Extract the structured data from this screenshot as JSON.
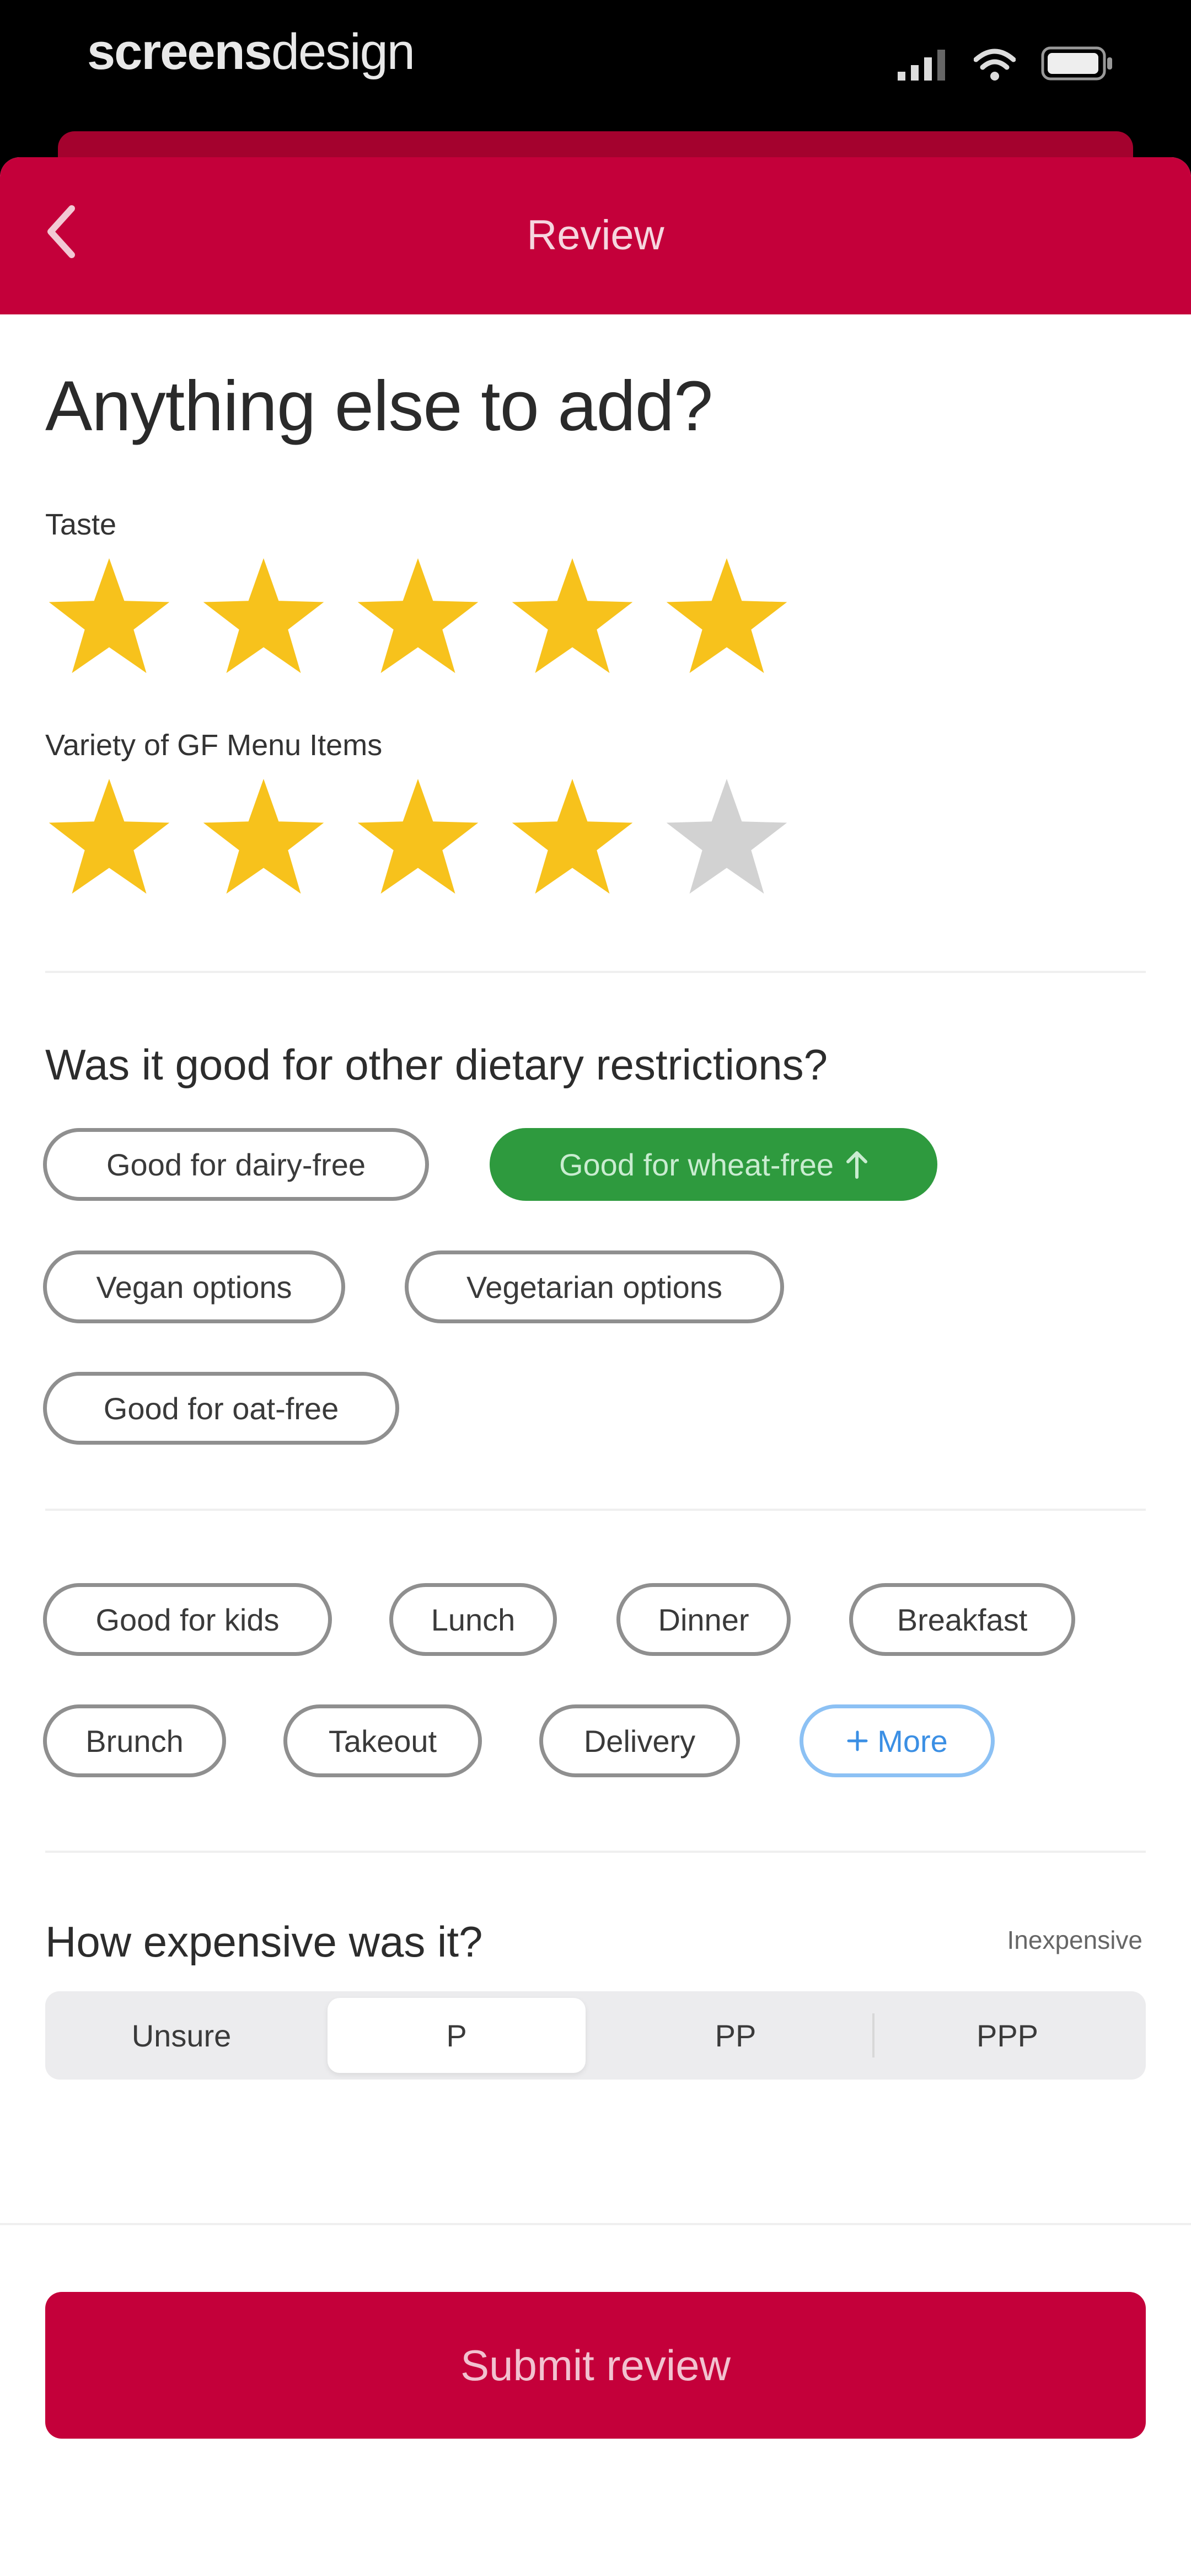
{
  "status_bar": {
    "brand_bold": "screens",
    "brand_light": "design"
  },
  "header": {
    "title": "Review",
    "back_icon": "chevron-left-icon"
  },
  "heading": "Anything else to add?",
  "ratings": [
    {
      "label": "Taste",
      "value": 5,
      "max": 5
    },
    {
      "label": "Variety of GF Menu Items",
      "value": 4,
      "max": 5
    }
  ],
  "dietary": {
    "question": "Was it good for other dietary restrictions?",
    "chips": [
      {
        "label": "Good for dairy-free",
        "selected": false
      },
      {
        "label": "Good for wheat-free",
        "selected": true
      },
      {
        "label": "Vegan options",
        "selected": false
      },
      {
        "label": "Vegetarian options",
        "selected": false
      },
      {
        "label": "Good for oat-free",
        "selected": false
      }
    ]
  },
  "tags": {
    "chips": [
      {
        "label": "Good for kids"
      },
      {
        "label": "Lunch"
      },
      {
        "label": "Dinner"
      },
      {
        "label": "Breakfast"
      },
      {
        "label": "Brunch"
      },
      {
        "label": "Takeout"
      },
      {
        "label": "Delivery"
      }
    ],
    "more_label": "More"
  },
  "price": {
    "question": "How expensive was it?",
    "value_label": "Inexpensive",
    "options": [
      "Unsure",
      "P",
      "PP",
      "PPP"
    ],
    "selected_index": 1
  },
  "submit_label": "Submit review",
  "colors": {
    "brand": "#c4003a",
    "star_on": "#f7c21c",
    "star_off": "#d2d2d2",
    "chip_selected": "#2e9a3e",
    "link": "#3b8fe4"
  }
}
